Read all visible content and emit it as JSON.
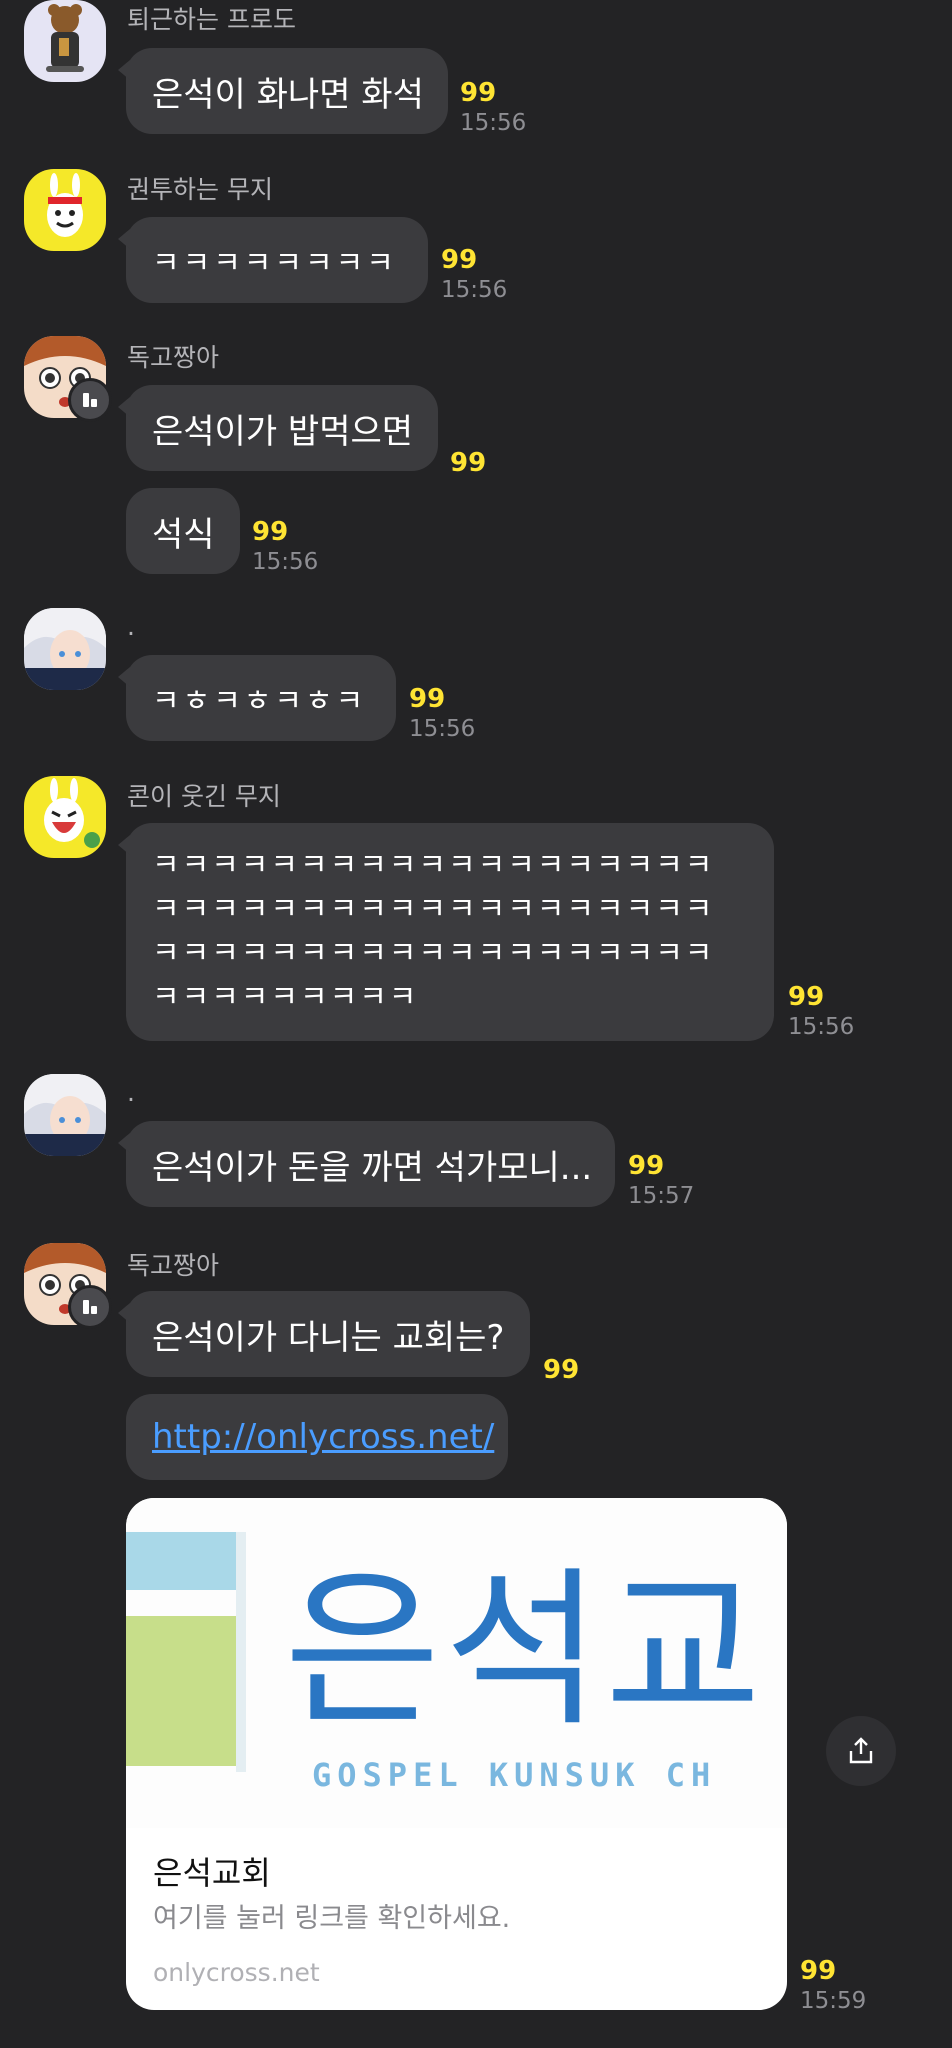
{
  "messages": {
    "m1": {
      "sender": "퇴근하는 프로도",
      "text": "은석이 화나면 화석",
      "count": "99",
      "time": "15:56"
    },
    "m2": {
      "sender": "권투하는 무지",
      "text": "ㅋㅋㅋㅋㅋㅋㅋㅋ",
      "count": "99",
      "time": "15:56"
    },
    "m3": {
      "sender": "독고짱아",
      "text1": "은석이가 밥먹으면",
      "count1": "99",
      "text2": "석식",
      "count2": "99",
      "time": "15:56"
    },
    "m4": {
      "sender": ".",
      "text": "ㅋㅎㅋㅎㅋㅎㅋ",
      "count": "99",
      "time": "15:56"
    },
    "m5": {
      "sender": "콘이 웃긴 무지",
      "lines": [
        "ㅋㅋㅋㅋㅋㅋㅋㅋㅋㅋㅋㅋㅋㅋㅋㅋㅋㅋㅋ",
        "ㅋㅋㅋㅋㅋㅋㅋㅋㅋㅋㅋㅋㅋㅋㅋㅋㅋㅋㅋ",
        "ㅋㅋㅋㅋㅋㅋㅋㅋㅋㅋㅋㅋㅋㅋㅋㅋㅋㅋㅋ",
        "ㅋㅋㅋㅋㅋㅋㅋㅋㅋ"
      ],
      "count": "99",
      "time": "15:56"
    },
    "m6": {
      "sender": ".",
      "text": "은석이가 돈을 까면 석가모니...",
      "count": "99",
      "time": "15:57"
    },
    "m7": {
      "sender": "독고짱아",
      "text1": "은석이가 다니는 교회는?",
      "count1": "99",
      "link": "http://onlycross.net/",
      "card": {
        "logo_text": "은석교",
        "logo_sub": "GOSPEL KUNSUK CH",
        "title": "은석교회",
        "desc": "여기를 눌러 링크를 확인하세요.",
        "domain": "onlycross.net"
      },
      "count2": "99",
      "time": "15:59"
    }
  },
  "colors": {
    "background": "#232325",
    "bubble": "#3b3b3e",
    "unread_count": "#ffe433",
    "link": "#4a9dff"
  },
  "icons": {
    "share": "share-icon"
  }
}
